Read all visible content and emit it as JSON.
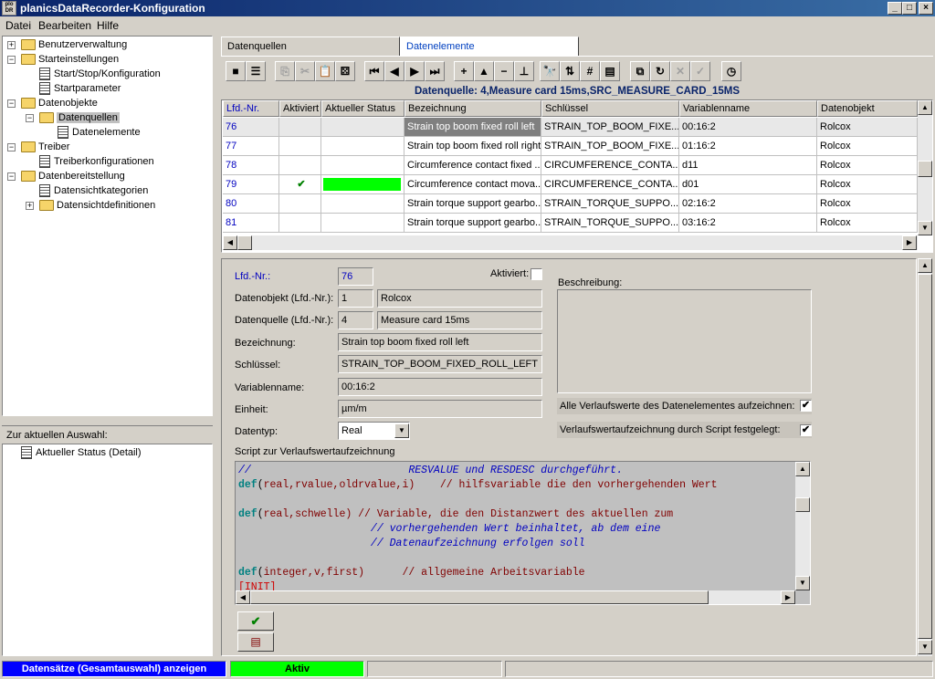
{
  "window": {
    "title": "planicsDataRecorder-Konfiguration",
    "icon_text": "plo DR"
  },
  "menu": {
    "file": "Datei",
    "edit": "Bearbeiten",
    "help": "Hilfe"
  },
  "tree": {
    "items": [
      {
        "label": "Benutzerverwaltung"
      },
      {
        "label": "Starteinstellungen"
      },
      {
        "label": "Start/Stop/Konfiguration"
      },
      {
        "label": "Startparameter"
      },
      {
        "label": "Datenobjekte"
      },
      {
        "label": "Datenquellen"
      },
      {
        "label": "Datenelemente"
      },
      {
        "label": "Treiber"
      },
      {
        "label": "Treiberkonfigurationen"
      },
      {
        "label": "Datenbereitstellung"
      },
      {
        "label": "Datensichtkategorien"
      },
      {
        "label": "Datensichtdefinitionen"
      }
    ]
  },
  "selection_panel": {
    "header": "Zur aktuellen Auswahl:",
    "item": "Aktueller Status (Detail)"
  },
  "tabs": [
    {
      "label": "Datenquellen"
    },
    {
      "label": "Datenelemente"
    }
  ],
  "grid": {
    "caption": "Datenquelle: 4,Measure card 15ms,SRC_MEASURE_CARD_15MS",
    "columns": [
      "Lfd.-Nr.",
      "Aktiviert",
      "Aktueller Status",
      "Bezeichnung",
      "Schlüssel",
      "Variablenname",
      "Datenobjekt"
    ],
    "rows": [
      {
        "nr": "76",
        "active": "",
        "status": "",
        "name": "Strain top boom fixed roll left",
        "key": "STRAIN_TOP_BOOM_FIXE...",
        "var": "00:16:2",
        "obj": "Rolcox"
      },
      {
        "nr": "77",
        "active": "",
        "status": "",
        "name": "Strain top boom fixed roll right",
        "key": "STRAIN_TOP_BOOM_FIXE...",
        "var": "01:16:2",
        "obj": "Rolcox"
      },
      {
        "nr": "78",
        "active": "",
        "status": "",
        "name": "Circumference contact fixed ...",
        "key": "CIRCUMFERENCE_CONTA...",
        "var": "d11",
        "obj": "Rolcox"
      },
      {
        "nr": "79",
        "active": "✔",
        "status": "green",
        "name": "Circumference contact mova...",
        "key": "CIRCUMFERENCE_CONTA...",
        "var": "d01",
        "obj": "Rolcox"
      },
      {
        "nr": "80",
        "active": "",
        "status": "",
        "name": "Strain torque support gearbo...",
        "key": "STRAIN_TORQUE_SUPPO...",
        "var": "02:16:2",
        "obj": "Rolcox"
      },
      {
        "nr": "81",
        "active": "",
        "status": "",
        "name": "Strain torque support gearbo...",
        "key": "STRAIN_TORQUE_SUPPO...",
        "var": "03:16:2",
        "obj": "Rolcox"
      }
    ]
  },
  "form": {
    "lfd_label": "Lfd.-Nr.:",
    "lfd_value": "76",
    "active_label": "Aktiviert:",
    "obj_label": "Datenobjekt (Lfd.-Nr.):",
    "obj_nr": "1",
    "obj_name": "Rolcox",
    "src_label": "Datenquelle (Lfd.-Nr.):",
    "src_nr": "4",
    "src_name": "Measure card 15ms",
    "name_label": "Bezeichnung:",
    "name_value": "Strain top boom fixed roll left",
    "key_label": "Schlüssel:",
    "key_value": "STRAIN_TOP_BOOM_FIXED_ROLL_LEFT",
    "var_label": "Variablenname:",
    "var_value": "00:16:2",
    "unit_label": "Einheit:",
    "unit_value": "µm/m",
    "type_label": "Datentyp:",
    "type_value": "Real",
    "desc_label": "Beschreibung:",
    "record_all_label": "Alle Verlaufswerte des Datenelementes aufzeichnen:",
    "record_script_label": "Verlaufswertaufzeichnung durch Script festgelegt:",
    "script_label": "Script zur Verlaufswertaufzeichnung"
  },
  "script_lines": [
    "//                         RESVALUE und RESDESC durchgeführt.",
    "def(real,rvalue,oldrvalue,i)    // hilfsvariable die den vorhergehenden Wert",
    "",
    "def(real,schwelle) // Variable, die den Distanzwert des aktuellen zum",
    "                     // vorhergehenden Wert beinhaltet, ab dem eine",
    "                     // Datenaufzeichnung erfolgen soll",
    "",
    "def(integer,v,first)      // allgemeine Arbeitsvariable",
    "[INIT]"
  ],
  "status": {
    "left": "Datensätze (Gesamtauswahl) anzeigen",
    "mid": "Aktiv"
  },
  "colors": {
    "link_blue": "#0000c0",
    "status_green": "#00ff00",
    "title_blue": "#0a246a"
  }
}
